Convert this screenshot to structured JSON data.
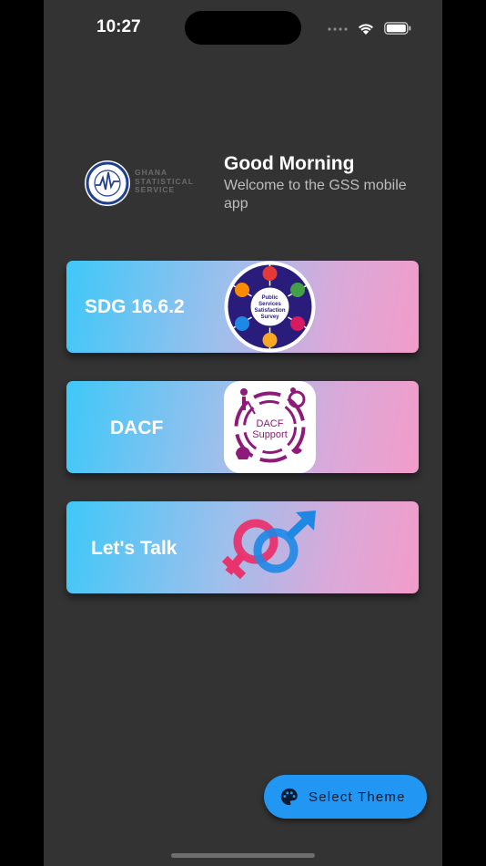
{
  "status_bar": {
    "time": "10:27"
  },
  "header": {
    "logo_lines": [
      "GHANA",
      "STATISTICAL",
      "SERVICE"
    ],
    "seal_text_top": "STATISTICAL SERVICE",
    "seal_text_bottom": "GHANA",
    "greeting": "Good Morning",
    "subtitle": "Welcome to the GSS mobile app"
  },
  "cards": [
    {
      "label": "SDG 16.6.2",
      "badge_text": [
        "Public",
        "Services",
        "Satisfaction",
        "Survey"
      ]
    },
    {
      "label": "DACF",
      "badge_text": [
        "DACF",
        "Support"
      ]
    },
    {
      "label": "Let's Talk"
    }
  ],
  "fab": {
    "label": "Select Theme",
    "icon": "palette-icon"
  },
  "colors": {
    "background": "#333333",
    "card_gradient_start": "#3ec8f8",
    "card_gradient_end": "#f39cc9",
    "fab": "#2196f3",
    "female_symbol": "#e8336d",
    "male_symbol": "#1e88e5"
  }
}
